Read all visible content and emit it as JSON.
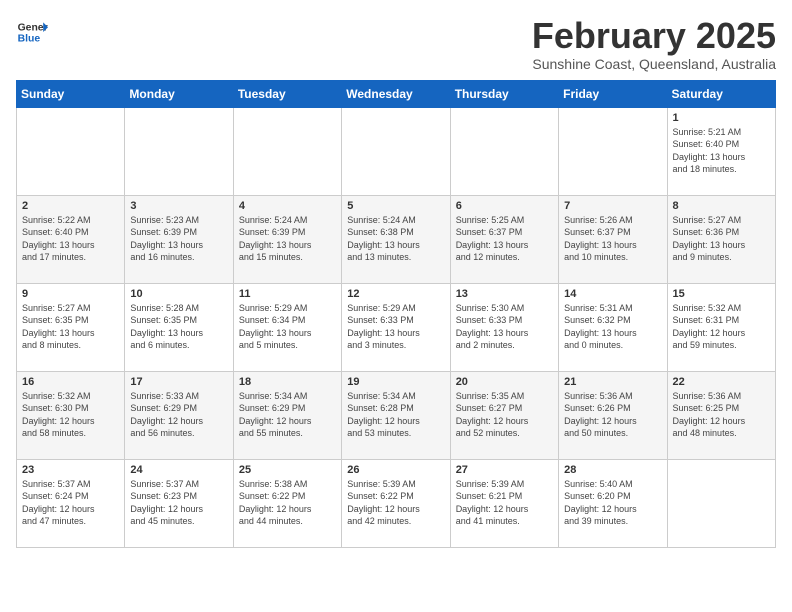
{
  "header": {
    "logo_general": "General",
    "logo_blue": "Blue",
    "month_title": "February 2025",
    "subtitle": "Sunshine Coast, Queensland, Australia"
  },
  "weekdays": [
    "Sunday",
    "Monday",
    "Tuesday",
    "Wednesday",
    "Thursday",
    "Friday",
    "Saturday"
  ],
  "weeks": [
    [
      {
        "day": "",
        "info": ""
      },
      {
        "day": "",
        "info": ""
      },
      {
        "day": "",
        "info": ""
      },
      {
        "day": "",
        "info": ""
      },
      {
        "day": "",
        "info": ""
      },
      {
        "day": "",
        "info": ""
      },
      {
        "day": "1",
        "info": "Sunrise: 5:21 AM\nSunset: 6:40 PM\nDaylight: 13 hours\nand 18 minutes."
      }
    ],
    [
      {
        "day": "2",
        "info": "Sunrise: 5:22 AM\nSunset: 6:40 PM\nDaylight: 13 hours\nand 17 minutes."
      },
      {
        "day": "3",
        "info": "Sunrise: 5:23 AM\nSunset: 6:39 PM\nDaylight: 13 hours\nand 16 minutes."
      },
      {
        "day": "4",
        "info": "Sunrise: 5:24 AM\nSunset: 6:39 PM\nDaylight: 13 hours\nand 15 minutes."
      },
      {
        "day": "5",
        "info": "Sunrise: 5:24 AM\nSunset: 6:38 PM\nDaylight: 13 hours\nand 13 minutes."
      },
      {
        "day": "6",
        "info": "Sunrise: 5:25 AM\nSunset: 6:37 PM\nDaylight: 13 hours\nand 12 minutes."
      },
      {
        "day": "7",
        "info": "Sunrise: 5:26 AM\nSunset: 6:37 PM\nDaylight: 13 hours\nand 10 minutes."
      },
      {
        "day": "8",
        "info": "Sunrise: 5:27 AM\nSunset: 6:36 PM\nDaylight: 13 hours\nand 9 minutes."
      }
    ],
    [
      {
        "day": "9",
        "info": "Sunrise: 5:27 AM\nSunset: 6:35 PM\nDaylight: 13 hours\nand 8 minutes."
      },
      {
        "day": "10",
        "info": "Sunrise: 5:28 AM\nSunset: 6:35 PM\nDaylight: 13 hours\nand 6 minutes."
      },
      {
        "day": "11",
        "info": "Sunrise: 5:29 AM\nSunset: 6:34 PM\nDaylight: 13 hours\nand 5 minutes."
      },
      {
        "day": "12",
        "info": "Sunrise: 5:29 AM\nSunset: 6:33 PM\nDaylight: 13 hours\nand 3 minutes."
      },
      {
        "day": "13",
        "info": "Sunrise: 5:30 AM\nSunset: 6:33 PM\nDaylight: 13 hours\nand 2 minutes."
      },
      {
        "day": "14",
        "info": "Sunrise: 5:31 AM\nSunset: 6:32 PM\nDaylight: 13 hours\nand 0 minutes."
      },
      {
        "day": "15",
        "info": "Sunrise: 5:32 AM\nSunset: 6:31 PM\nDaylight: 12 hours\nand 59 minutes."
      }
    ],
    [
      {
        "day": "16",
        "info": "Sunrise: 5:32 AM\nSunset: 6:30 PM\nDaylight: 12 hours\nand 58 minutes."
      },
      {
        "day": "17",
        "info": "Sunrise: 5:33 AM\nSunset: 6:29 PM\nDaylight: 12 hours\nand 56 minutes."
      },
      {
        "day": "18",
        "info": "Sunrise: 5:34 AM\nSunset: 6:29 PM\nDaylight: 12 hours\nand 55 minutes."
      },
      {
        "day": "19",
        "info": "Sunrise: 5:34 AM\nSunset: 6:28 PM\nDaylight: 12 hours\nand 53 minutes."
      },
      {
        "day": "20",
        "info": "Sunrise: 5:35 AM\nSunset: 6:27 PM\nDaylight: 12 hours\nand 52 minutes."
      },
      {
        "day": "21",
        "info": "Sunrise: 5:36 AM\nSunset: 6:26 PM\nDaylight: 12 hours\nand 50 minutes."
      },
      {
        "day": "22",
        "info": "Sunrise: 5:36 AM\nSunset: 6:25 PM\nDaylight: 12 hours\nand 48 minutes."
      }
    ],
    [
      {
        "day": "23",
        "info": "Sunrise: 5:37 AM\nSunset: 6:24 PM\nDaylight: 12 hours\nand 47 minutes."
      },
      {
        "day": "24",
        "info": "Sunrise: 5:37 AM\nSunset: 6:23 PM\nDaylight: 12 hours\nand 45 minutes."
      },
      {
        "day": "25",
        "info": "Sunrise: 5:38 AM\nSunset: 6:22 PM\nDaylight: 12 hours\nand 44 minutes."
      },
      {
        "day": "26",
        "info": "Sunrise: 5:39 AM\nSunset: 6:22 PM\nDaylight: 12 hours\nand 42 minutes."
      },
      {
        "day": "27",
        "info": "Sunrise: 5:39 AM\nSunset: 6:21 PM\nDaylight: 12 hours\nand 41 minutes."
      },
      {
        "day": "28",
        "info": "Sunrise: 5:40 AM\nSunset: 6:20 PM\nDaylight: 12 hours\nand 39 minutes."
      },
      {
        "day": "",
        "info": ""
      }
    ]
  ]
}
